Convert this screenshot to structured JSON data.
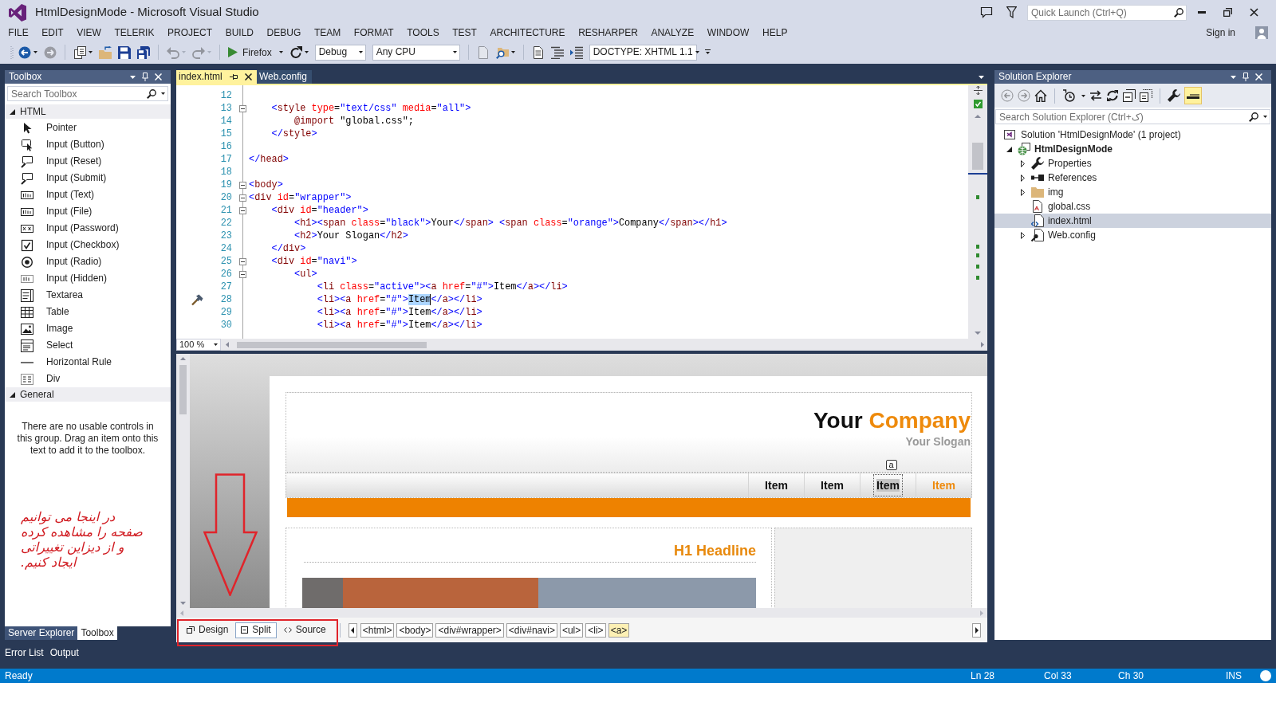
{
  "window": {
    "title": "HtmlDesignMode - Microsoft Visual Studio",
    "quick_launch": {
      "placeholder": "Quick Launch (Ctrl+Q)"
    },
    "sign_in": "Sign in"
  },
  "menu": [
    "FILE",
    "EDIT",
    "VIEW",
    "TELERIK",
    "PROJECT",
    "BUILD",
    "DEBUG",
    "TEAM",
    "FORMAT",
    "TOOLS",
    "TEST",
    "ARCHITECTURE",
    "RESHARPER",
    "ANALYZE",
    "WINDOW",
    "HELP"
  ],
  "toolbar": [
    {
      "kind": "back",
      "dropdown": true,
      "disabled": false
    },
    {
      "kind": "forward",
      "disabled": true
    },
    {
      "kind": "separator"
    },
    {
      "kind": "new-project",
      "dropdown": true,
      "disabled": false
    },
    {
      "kind": "open",
      "disabled": false
    },
    {
      "kind": "save",
      "disabled": false
    },
    {
      "kind": "save-all",
      "disabled": false
    },
    {
      "kind": "separator"
    },
    {
      "kind": "undo",
      "dropdown": true,
      "disabled": true
    },
    {
      "kind": "redo",
      "dropdown": true,
      "disabled": true
    },
    {
      "kind": "separator"
    },
    {
      "kind": "run",
      "label": "Firefox",
      "dropdown": true
    },
    {
      "kind": "refresh",
      "dropdown": true,
      "disabled": false
    },
    {
      "kind": "select",
      "value": "Debug"
    },
    {
      "kind": "select",
      "value": "Any CPU"
    },
    {
      "kind": "separator"
    },
    {
      "kind": "page",
      "disabled": true
    },
    {
      "kind": "find",
      "dropdown": true,
      "disabled": false
    },
    {
      "kind": "separator"
    },
    {
      "kind": "document",
      "disabled": false
    },
    {
      "kind": "outdent",
      "disabled": false
    },
    {
      "kind": "indent",
      "disabled": false
    },
    {
      "kind": "select",
      "value": "DOCTYPE: XHTML 1.1"
    },
    {
      "kind": "overflow"
    }
  ],
  "toolbox": {
    "title": "Toolbox",
    "search": {
      "placeholder": "Search Toolbox"
    },
    "groups": [
      {
        "name": "HTML",
        "expanded": true,
        "items": [
          {
            "kind": "pointer",
            "label": "Pointer"
          },
          {
            "kind": "button",
            "label": "Input (Button)"
          },
          {
            "kind": "reset",
            "label": "Input (Reset)"
          },
          {
            "kind": "submit",
            "label": "Input (Submit)"
          },
          {
            "kind": "text",
            "label": "Input (Text)"
          },
          {
            "kind": "file",
            "label": "Input (File)"
          },
          {
            "kind": "password",
            "label": "Input (Password)"
          },
          {
            "kind": "checkbox",
            "label": "Input (Checkbox)"
          },
          {
            "kind": "radio",
            "label": "Input (Radio)"
          },
          {
            "kind": "hidden",
            "label": "Input (Hidden)"
          },
          {
            "kind": "textarea",
            "label": "Textarea"
          },
          {
            "kind": "table",
            "label": "Table"
          },
          {
            "kind": "image",
            "label": "Image"
          },
          {
            "kind": "select",
            "label": "Select"
          },
          {
            "kind": "rule",
            "label": "Horizontal Rule"
          },
          {
            "kind": "div",
            "label": "Div"
          }
        ]
      },
      {
        "name": "General",
        "expanded": true,
        "message": "There are no usable controls in this group. Drag an item onto this text to add it to the toolbox."
      }
    ],
    "tabs": [
      {
        "label": "Server Explorer",
        "selected": false
      },
      {
        "label": "Toolbox",
        "selected": true
      }
    ]
  },
  "annotation_note": "در اینجا می توانیم صفحه را مشاهده کرده و از دیزاین تغییراتی ایجاد کنیم.",
  "editor": {
    "tabs": [
      {
        "label": "index.html",
        "selected": true
      },
      {
        "label": "Web.config",
        "selected": false
      }
    ],
    "lines": [
      {
        "number": "12",
        "fold": false,
        "hint": false
      },
      {
        "number": "13",
        "parts": [
          {
            "text": "    <style type=\"text/css\" media=\"all\">",
            "selected": false
          }
        ],
        "fold": true,
        "hint": false
      },
      {
        "number": "14",
        "parts": [
          {
            "text": "        @import \"global.css\";",
            "selected": false
          }
        ],
        "fold": false,
        "hint": false
      },
      {
        "number": "15",
        "parts": [
          {
            "text": "    </style>",
            "selected": false
          }
        ],
        "fold": false,
        "hint": false
      },
      {
        "number": "16",
        "fold": false,
        "hint": false
      },
      {
        "number": "17",
        "parts": [
          {
            "text": "</head>",
            "selected": false
          }
        ],
        "fold": false,
        "hint": false
      },
      {
        "number": "18",
        "fold": false,
        "hint": false
      },
      {
        "number": "19",
        "parts": [
          {
            "text": "<body>",
            "selected": false
          }
        ],
        "fold": true,
        "hint": false
      },
      {
        "number": "20",
        "parts": [
          {
            "text": "<div id=\"wrapper\">",
            "selected": false
          }
        ],
        "fold": true,
        "hint": false
      },
      {
        "number": "21",
        "parts": [
          {
            "text": "    <div id=\"header\">",
            "selected": false
          }
        ],
        "fold": true,
        "hint": false
      },
      {
        "number": "22",
        "parts": [
          {
            "text": "        <h1><span class=\"black\">Your</span> <span class=\"orange\">Company</span></h1>",
            "selected": false
          }
        ],
        "fold": false,
        "hint": false
      },
      {
        "number": "23",
        "parts": [
          {
            "text": "        <h2>Your Slogan</h2>",
            "selected": false
          }
        ],
        "fold": false,
        "hint": false
      },
      {
        "number": "24",
        "parts": [
          {
            "text": "    </div>",
            "selected": false
          }
        ],
        "fold": false,
        "hint": false
      },
      {
        "number": "25",
        "parts": [
          {
            "text": "    <div id=\"navi\">",
            "selected": false
          }
        ],
        "fold": true,
        "hint": false
      },
      {
        "number": "26",
        "parts": [
          {
            "text": "        <ul>",
            "selected": false
          }
        ],
        "fold": true,
        "hint": false
      },
      {
        "number": "27",
        "parts": [
          {
            "text": "            <li class=\"active\"><a href=\"#\">Item</a></li>",
            "selected": false
          }
        ],
        "fold": false,
        "hint": false
      },
      {
        "number": "28",
        "parts": [
          {
            "text": "            <li><a href=\"#\">",
            "selected": false
          },
          {
            "text": "Item",
            "selected": true
          },
          {
            "text": "</a></li>",
            "selected": false
          }
        ],
        "fold": false,
        "hint": true
      },
      {
        "number": "29",
        "parts": [
          {
            "text": "            <li><a href=\"#\">Item</a></li>",
            "selected": false
          }
        ],
        "fold": false,
        "hint": false
      },
      {
        "number": "30",
        "parts": [
          {
            "text": "            <li><a href=\"#\">Item</a></li>",
            "selected": false
          }
        ],
        "fold": false,
        "hint": false
      }
    ],
    "zoom": "100 %",
    "design": {
      "heading_lead": "Your",
      "heading_accent": "Company",
      "slogan": "Your Slogan",
      "nav": [
        {
          "label": "Item",
          "active": false,
          "selected": false
        },
        {
          "label": "Item",
          "active": false,
          "selected": false
        },
        {
          "label": "Item",
          "active": false,
          "selected": true
        },
        {
          "label": "Item",
          "active": true,
          "selected": false
        }
      ],
      "selection_tag": "a",
      "headline": "H1 Headline"
    },
    "views": [
      {
        "kind": "design",
        "label": "Design",
        "selected": false
      },
      {
        "kind": "split",
        "label": "Split",
        "selected": true
      },
      {
        "kind": "source",
        "label": "Source",
        "selected": false
      }
    ],
    "breadcrumb": [
      {
        "label": "<html>",
        "selected": false
      },
      {
        "label": "<body>",
        "selected": false
      },
      {
        "label": "<div#wrapper>",
        "selected": false
      },
      {
        "label": "<div#navi>",
        "selected": false
      },
      {
        "label": "<ul>",
        "selected": false
      },
      {
        "label": "<li>",
        "selected": false
      },
      {
        "label": "<a>",
        "selected": true
      }
    ]
  },
  "solution_explorer": {
    "title": "Solution Explorer",
    "toolbar": [
      {
        "kind": "back",
        "disabled": true,
        "on": false
      },
      {
        "kind": "forward",
        "disabled": true,
        "on": false
      },
      {
        "kind": "home",
        "disabled": false,
        "on": false
      },
      {
        "kind": "separator"
      },
      {
        "kind": "history",
        "disabled": false,
        "dropdown": true,
        "on": false
      },
      {
        "kind": "sync",
        "disabled": false,
        "on": false
      },
      {
        "kind": "refresh",
        "disabled": false,
        "on": false
      },
      {
        "kind": "collapse",
        "disabled": false,
        "on": false
      },
      {
        "kind": "show-all",
        "disabled": false,
        "on": false
      },
      {
        "kind": "separator"
      },
      {
        "kind": "properties",
        "disabled": false,
        "on": false
      },
      {
        "kind": "preview",
        "disabled": false,
        "on": true
      }
    ],
    "search": {
      "placeholder": "Search Solution Explorer (Ctrl+ک)"
    },
    "tree": [
      {
        "label": "Solution 'HtmlDesignMode' (1 project)",
        "kind": "solution",
        "selected": false,
        "startup": false,
        "children": [
          {
            "label": "HtmlDesignMode",
            "kind": "project",
            "expanded": true,
            "selected": false,
            "startup": true,
            "children": [
              {
                "label": "Properties",
                "kind": "properties",
                "expanded": false,
                "selected": false,
                "startup": false
              },
              {
                "label": "References",
                "kind": "references",
                "expanded": false,
                "selected": false,
                "startup": false
              },
              {
                "label": "img",
                "kind": "folder",
                "expanded": false,
                "selected": false,
                "startup": false
              },
              {
                "label": "global.css",
                "kind": "css",
                "selected": false,
                "startup": false
              },
              {
                "label": "index.html",
                "kind": "html",
                "selected": true,
                "startup": false
              },
              {
                "label": "Web.config",
                "kind": "config",
                "expanded": false,
                "selected": false,
                "startup": false
              }
            ]
          }
        ]
      }
    ]
  },
  "bottom_tabs": [
    "Error List",
    "Output"
  ],
  "status_bar": {
    "message": "Ready",
    "line": "Ln 28",
    "column": "Col 33",
    "char": "Ch 30",
    "mode": "INS"
  }
}
